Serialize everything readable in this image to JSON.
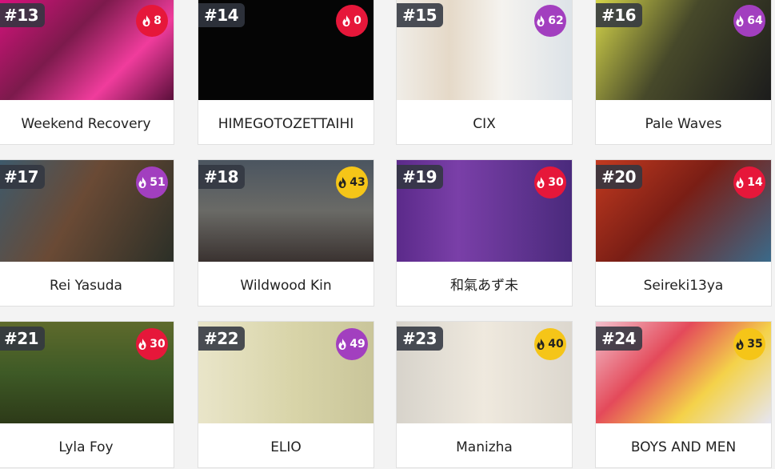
{
  "cards": [
    {
      "rank": "#13",
      "score": "8",
      "badge_color": "#e6173a",
      "name": "Weekend Recovery",
      "image_bg": "linear-gradient(135deg,#d8127e 0%,#7c1a4c 40%,#f03c9c 70%,#5a0f3a 100%)"
    },
    {
      "rank": "#14",
      "score": "0",
      "badge_color": "#e6173a",
      "name": "HIMEGOTOZETTAIHI",
      "image_bg": "#050505"
    },
    {
      "rank": "#15",
      "score": "62",
      "badge_color": "#a23fbf",
      "name": "CIX",
      "image_bg": "linear-gradient(90deg,#f0ede7 0%,#e5d9c8 30%,#f5f3ef 60%,#dde3e8 100%)"
    },
    {
      "rank": "#16",
      "score": "64",
      "badge_color": "#a23fbf",
      "name": "Pale Waves",
      "image_bg": "linear-gradient(120deg,#d6d64a 0%,#47492a 45%,#1c1c1c 100%)"
    },
    {
      "rank": "#17",
      "score": "51",
      "badge_color": "#a23fbf",
      "name": "Rei Yasuda",
      "image_bg": "linear-gradient(120deg,#3d5a6c 0%,#6a4a35 45%,#2b2f27 100%)"
    },
    {
      "rank": "#18",
      "score": "43",
      "badge_color": "#f5c518",
      "name": "Wildwood Kin",
      "image_bg": "linear-gradient(180deg,#4b5560 0%,#6a6a66 50%,#3a3230 100%)"
    },
    {
      "rank": "#19",
      "score": "30",
      "badge_color": "#e6173a",
      "name": "和氣あず未",
      "image_bg": "linear-gradient(90deg,#5b2a8a 0%,#7a3fa8 35%,#4a2a7c 100%)"
    },
    {
      "rank": "#20",
      "score": "14",
      "badge_color": "#e6173a",
      "name": "Seireki13ya",
      "image_bg": "linear-gradient(135deg,#c23a20 0%,#7a1e15 45%,#3a6a8a 100%)"
    },
    {
      "rank": "#21",
      "score": "30",
      "badge_color": "#e6173a",
      "name": "Lyla Foy",
      "image_bg": "linear-gradient(180deg,#5e6a2c 0%,#3e5a26 50%,#2d3a18 100%)"
    },
    {
      "rank": "#22",
      "score": "49",
      "badge_color": "#a23fbf",
      "name": "ELIO",
      "image_bg": "linear-gradient(90deg,#e9e5c9 0%,#d8d4a8 55%,#c9c59a 100%)"
    },
    {
      "rank": "#23",
      "score": "40",
      "badge_color": "#f5c518",
      "name": "Manizha",
      "image_bg": "linear-gradient(90deg,#d7d3cb 0%,#efe9de 50%,#dcd7ce 100%)"
    },
    {
      "rank": "#24",
      "score": "35",
      "badge_color": "#f5c518",
      "name": "BOYS AND MEN",
      "image_bg": "linear-gradient(135deg,#f2c0cc 0%,#e44a5a 35%,#f4d24a 65%,#e6e6f2 100%)"
    }
  ],
  "icons": {
    "badge": "fire-icon"
  }
}
